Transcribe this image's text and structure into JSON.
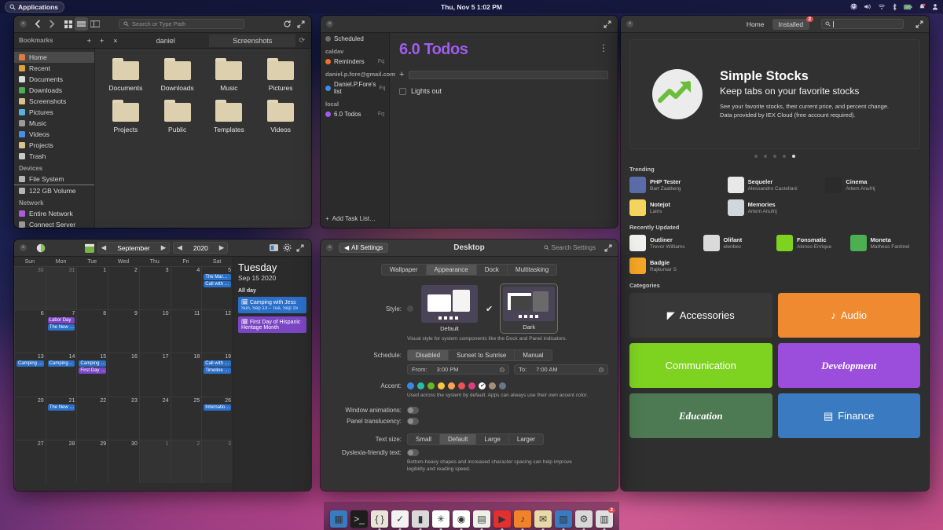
{
  "panel": {
    "applications_label": "Applications",
    "clock": "Thu, Nov 5   1:02 PM",
    "tray_icons": [
      "power-icon",
      "volume-icon",
      "wifi-icon",
      "bluetooth-icon",
      "battery-icon",
      "notification-icon",
      "session-icon"
    ]
  },
  "files": {
    "title": "",
    "search_placeholder": "Search or Type Path",
    "tabs": [
      {
        "label": "daniel",
        "active": false
      },
      {
        "label": "Screenshots",
        "active": true
      }
    ],
    "sidebar": [
      {
        "header": "Bookmarks"
      },
      {
        "label": "Home",
        "icon": "home-icon",
        "color": "#e07a3a",
        "selected": true
      },
      {
        "label": "Recent",
        "icon": "recent-icon",
        "color": "#e0a33a"
      },
      {
        "label": "Documents",
        "icon": "document-icon",
        "color": "#dcdcdc"
      },
      {
        "label": "Downloads",
        "icon": "download-icon",
        "color": "#4caf50"
      },
      {
        "label": "Screenshots",
        "icon": "folder-icon",
        "color": "#d8c38f"
      },
      {
        "label": "Pictures",
        "icon": "pictures-icon",
        "color": "#5ab0e0"
      },
      {
        "label": "Music",
        "icon": "music-icon",
        "color": "#9a9a9a"
      },
      {
        "label": "Videos",
        "icon": "video-icon",
        "color": "#4a8ee0"
      },
      {
        "label": "Projects",
        "icon": "folder-icon",
        "color": "#d8c38f"
      },
      {
        "label": "Trash",
        "icon": "trash-icon",
        "color": "#c8c8c8"
      },
      {
        "header": "Devices"
      },
      {
        "label": "File System",
        "icon": "drive-icon",
        "color": "#b5b5b5",
        "underline": true
      },
      {
        "label": "122 GB Volume",
        "icon": "drive-icon",
        "color": "#b5b5b5"
      },
      {
        "header": "Network"
      },
      {
        "label": "Entire Network",
        "icon": "network-icon",
        "color": "#b15adc"
      },
      {
        "label": "Connect Server",
        "icon": "connect-icon",
        "color": "#9a9a9a"
      }
    ],
    "folders": [
      {
        "label": "Documents",
        "glyph": "doc"
      },
      {
        "label": "Downloads",
        "glyph": "down"
      },
      {
        "label": "Music",
        "glyph": "music"
      },
      {
        "label": "Pictures",
        "glyph": "pic"
      },
      {
        "label": "Projects",
        "glyph": ""
      },
      {
        "label": "Public",
        "glyph": "share"
      },
      {
        "label": "Templates",
        "glyph": "tmpl"
      },
      {
        "label": "Videos",
        "glyph": "vid"
      }
    ]
  },
  "todos": {
    "heading": "6.0 Todos",
    "new_task_placeholder": "",
    "sidebar": [
      {
        "type": "item",
        "label": "Scheduled",
        "icon": "clock-icon",
        "color": "#6e6e6e"
      },
      {
        "type": "group",
        "label": "caldav"
      },
      {
        "type": "item",
        "label": "Reminders",
        "color": "#f0712a",
        "count": "Fq"
      },
      {
        "type": "group",
        "label": "daniel.p.fore@gmail.com"
      },
      {
        "type": "item",
        "label": "Daniel.P.Fore's list",
        "color": "#3a8ee8",
        "count": "Fq"
      },
      {
        "type": "group",
        "label": "local"
      },
      {
        "type": "item",
        "label": "6.0 Todos",
        "color": "#a05cf0",
        "count": "Fq"
      }
    ],
    "add_list_label": "Add Task List…",
    "tasks": [
      {
        "label": "Lights out",
        "done": false
      }
    ]
  },
  "appcenter": {
    "tabs": [
      {
        "label": "Home",
        "active": false
      },
      {
        "label": "Installed",
        "active": true,
        "badge": "2"
      }
    ],
    "search_placeholder": "",
    "banner": {
      "title": "Simple Stocks",
      "subtitle": "Keep tabs on your favorite stocks",
      "line1": "See your favorite stocks, their current price, and percent change.",
      "line2": "Data provided by IEX Cloud (free account required).",
      "dots": 5,
      "active_dot": 5
    },
    "trending_header": "Trending",
    "trending": [
      {
        "name": "PHP Tester",
        "author": "Bart Zaalberg",
        "icon_color": "#5b6ba8",
        "glyph": "php"
      },
      {
        "name": "Sequeler",
        "author": "Alessandro Castellani",
        "icon_color": "#e8e8e8",
        "glyph": "db"
      },
      {
        "name": "Cinema",
        "author": "Artem Anufrij",
        "icon_color": "#2b2b2b",
        "glyph": "film"
      },
      {
        "name": "Notejot",
        "author": "Lains",
        "icon_color": "#f4d35e",
        "glyph": "note"
      },
      {
        "name": "Memories",
        "author": "Artem Anufrij",
        "icon_color": "#cfd8dc",
        "glyph": "photo"
      }
    ],
    "recently_updated_header": "Recently Updated",
    "recently_updated": [
      {
        "name": "Outliner",
        "author": "Trevor Williams",
        "icon_color": "#f0f0ee",
        "glyph": "list"
      },
      {
        "name": "Olifant",
        "author": "elenbec",
        "icon_color": "#dadada",
        "glyph": "olifant"
      },
      {
        "name": "Fonsmatic",
        "author": "Alonso Enrique",
        "icon_color": "#7ed321",
        "glyph": "quote"
      },
      {
        "name": "Moneta",
        "author": "Matheus Fantinel",
        "icon_color": "#4caf50",
        "glyph": "money"
      },
      {
        "name": "Badgie",
        "author": "Rajkumar S",
        "icon_color": "#f5a623",
        "glyph": "badge"
      }
    ],
    "categories_header": "Categories",
    "categories": [
      {
        "label": "Accessories",
        "bg": "#383838",
        "icon": "accessories-icon"
      },
      {
        "label": "Audio",
        "bg": "#f08a30",
        "icon": "music-note-icon"
      },
      {
        "label": "Communication",
        "bg": "#7ed321",
        "icon": ""
      },
      {
        "label": "Development",
        "bg": "#9b4ddb",
        "icon": ""
      },
      {
        "label": "Education",
        "bg": "#4d7a52",
        "icon": ""
      },
      {
        "label": "Finance",
        "bg": "#3a7ac0",
        "icon": "card-icon"
      }
    ]
  },
  "calendar": {
    "month": "September",
    "year": "2020",
    "day_names": [
      "Sun",
      "Mon",
      "Tue",
      "Wed",
      "Thu",
      "Fri",
      "Sat"
    ],
    "weeks": [
      [
        {
          "n": "30",
          "dim": true,
          "events": []
        },
        {
          "n": "31",
          "dim": true,
          "events": []
        },
        {
          "n": "1",
          "dim": false,
          "events": []
        },
        {
          "n": "2",
          "dim": false,
          "events": []
        },
        {
          "n": "3",
          "dim": false,
          "events": []
        },
        {
          "n": "4",
          "dim": false,
          "events": []
        },
        {
          "n": "5",
          "dim": false,
          "events": [
            {
              "label": "The Mar…",
              "color": "#2a6fc9"
            },
            {
              "label": "Call with …",
              "color": "#2a6fc9"
            }
          ]
        }
      ],
      [
        {
          "n": "6",
          "dim": false,
          "events": []
        },
        {
          "n": "7",
          "dim": false,
          "events": [
            {
              "label": "Labor Day",
              "color": "#7b46c4"
            },
            {
              "label": "The New …",
              "color": "#2a6fc9"
            }
          ]
        },
        {
          "n": "8",
          "dim": false,
          "events": []
        },
        {
          "n": "9",
          "dim": false,
          "events": []
        },
        {
          "n": "10",
          "dim": false,
          "events": []
        },
        {
          "n": "11",
          "dim": false,
          "events": []
        },
        {
          "n": "12",
          "dim": false,
          "events": []
        }
      ],
      [
        {
          "n": "13",
          "dim": false,
          "events": [
            {
              "label": "Camping …",
              "color": "#2a6fc9"
            }
          ]
        },
        {
          "n": "14",
          "dim": false,
          "events": [
            {
              "label": "Camping…",
              "color": "#2a6fc9"
            }
          ]
        },
        {
          "n": "15",
          "dim": false,
          "today": true,
          "events": [
            {
              "label": "Camping …",
              "color": "#2a6fc9"
            },
            {
              "label": "First Day …",
              "color": "#7b46c4"
            }
          ]
        },
        {
          "n": "16",
          "dim": false,
          "events": []
        },
        {
          "n": "17",
          "dim": false,
          "events": []
        },
        {
          "n": "18",
          "dim": false,
          "events": []
        },
        {
          "n": "19",
          "dim": false,
          "events": [
            {
              "label": "Call with …",
              "color": "#2a6fc9"
            },
            {
              "label": "Timeline …",
              "color": "#2a6fc9"
            }
          ]
        }
      ],
      [
        {
          "n": "20",
          "dim": false,
          "events": []
        },
        {
          "n": "21",
          "dim": false,
          "events": [
            {
              "label": "The New …",
              "color": "#2a6fc9"
            }
          ]
        },
        {
          "n": "22",
          "dim": false,
          "events": []
        },
        {
          "n": "23",
          "dim": false,
          "events": []
        },
        {
          "n": "24",
          "dim": false,
          "events": []
        },
        {
          "n": "25",
          "dim": false,
          "events": []
        },
        {
          "n": "26",
          "dim": false,
          "events": [
            {
              "label": "Internatio…",
              "color": "#2a6fc9"
            }
          ]
        }
      ],
      [
        {
          "n": "27",
          "dim": false,
          "events": []
        },
        {
          "n": "28",
          "dim": false,
          "events": []
        },
        {
          "n": "29",
          "dim": false,
          "events": []
        },
        {
          "n": "30",
          "dim": false,
          "events": []
        },
        {
          "n": "1",
          "dim": true,
          "events": []
        },
        {
          "n": "2",
          "dim": true,
          "events": []
        },
        {
          "n": "3",
          "dim": true,
          "events": []
        }
      ]
    ],
    "sidebar": {
      "weekday": "Tuesday",
      "date": "Sep 15 2020",
      "allday_label": "All day",
      "events": [
        {
          "title": "Camping with Jess",
          "sub": "Sun, Sep 13 – Tue, Sep 15",
          "color": "#2a6fc9"
        },
        {
          "title": "First Day of Hispanic Heritage Month",
          "sub": "",
          "color": "#7b46c4"
        }
      ]
    }
  },
  "settings": {
    "back_label": "All Settings",
    "title": "Desktop",
    "search_placeholder": "Search Settings",
    "tabs": [
      {
        "label": "Wallpaper",
        "active": false
      },
      {
        "label": "Appearance",
        "active": true
      },
      {
        "label": "Dock",
        "active": false
      },
      {
        "label": "Multitasking",
        "active": false
      }
    ],
    "style_label": "Style:",
    "styles": [
      {
        "label": "Default",
        "selected": false
      },
      {
        "label": "Dark",
        "selected": true
      }
    ],
    "style_desc": "Visual style for system components like the Dock and Panel indicators.",
    "schedule_label": "Schedule:",
    "schedule_options": [
      {
        "label": "Disabled",
        "active": true
      },
      {
        "label": "Sunset to Sunrise",
        "active": false
      },
      {
        "label": "Manual",
        "active": false
      }
    ],
    "from_label": "From:",
    "from_value": "3:00 PM",
    "to_label": "To:",
    "to_value": "7:00 AM",
    "accent_label": "Accent:",
    "accents": [
      {
        "color": "#3689e6",
        "selected": false
      },
      {
        "color": "#28bca3",
        "selected": false
      },
      {
        "color": "#68b723",
        "selected": false
      },
      {
        "color": "#f9c440",
        "selected": false
      },
      {
        "color": "#ffa154",
        "selected": false
      },
      {
        "color": "#ed5353",
        "selected": false
      },
      {
        "color": "#de3e80",
        "selected": false
      },
      {
        "color": "#ffffff",
        "selected": true
      },
      {
        "color": "#a3907c",
        "selected": false
      },
      {
        "color": "#667885",
        "selected": false
      }
    ],
    "accent_desc": "Used across the system by default. Apps can always use their own accent color.",
    "window_animations_label": "Window animations:",
    "panel_translucency_label": "Panel translucency:",
    "text_size_label": "Text size:",
    "text_sizes": [
      {
        "label": "Small",
        "active": false
      },
      {
        "label": "Default",
        "active": true
      },
      {
        "label": "Large",
        "active": false
      },
      {
        "label": "Larger",
        "active": false
      }
    ],
    "dyslexia_label": "Dyslexia-friendly text:",
    "dyslexia_desc": "Bottom-heavy shapes and increased character spacing can help improve legibility and reading speed."
  },
  "dock": {
    "items": [
      {
        "name": "multitasking-view",
        "bg": "#3a7ac0",
        "glyph": "▦",
        "running": false
      },
      {
        "name": "terminal",
        "bg": "#1d1d1d",
        "glyph": ">_",
        "running": false
      },
      {
        "name": "code",
        "bg": "#e8e4d8",
        "glyph": "{ }",
        "running": true
      },
      {
        "name": "tasks",
        "bg": "#f2f2f2",
        "glyph": "✓",
        "running": true
      },
      {
        "name": "files",
        "bg": "#d9d9d9",
        "glyph": "▮",
        "running": true
      },
      {
        "name": "slack",
        "bg": "#ffffff",
        "glyph": "✳",
        "running": true
      },
      {
        "name": "web-browser",
        "bg": "#ffffff",
        "glyph": "◉",
        "running": true
      },
      {
        "name": "spreadsheet",
        "bg": "#f0f0ea",
        "glyph": "▤",
        "running": true
      },
      {
        "name": "video",
        "bg": "#e03030",
        "glyph": "▶",
        "running": true
      },
      {
        "name": "music",
        "bg": "#f0822a",
        "glyph": "♪",
        "running": true
      },
      {
        "name": "mail",
        "bg": "#e8d9a8",
        "glyph": "✉",
        "running": true
      },
      {
        "name": "photos",
        "bg": "#3a7ac0",
        "glyph": "▨",
        "running": true
      },
      {
        "name": "settings",
        "bg": "#d8d8d8",
        "glyph": "⚙",
        "running": true
      },
      {
        "name": "appcenter",
        "bg": "#e0e0e0",
        "glyph": "▥",
        "running": true,
        "badge": "2"
      }
    ]
  }
}
